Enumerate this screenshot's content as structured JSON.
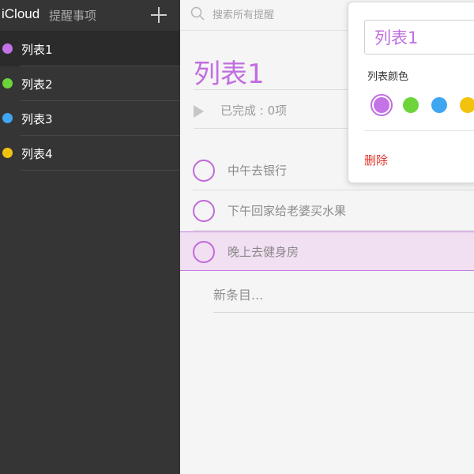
{
  "sidebar": {
    "brand": "iCloud",
    "app_name": "提醒事项",
    "lists": [
      {
        "label": "列表1",
        "color": "#c373e6",
        "active": true
      },
      {
        "label": "列表2",
        "color": "#6dd43a",
        "active": false
      },
      {
        "label": "列表3",
        "color": "#3fa6f2",
        "active": false
      },
      {
        "label": "列表4",
        "color": "#f2c30e",
        "active": false
      }
    ]
  },
  "main": {
    "search_placeholder": "搜索所有提醒",
    "title": "列表1",
    "completed": "已完成 : 0项",
    "reminders": [
      {
        "text": "中午去银行",
        "selected": false
      },
      {
        "text": "下午回家给老婆买水果",
        "selected": false
      },
      {
        "text": "晚上去健身房",
        "selected": true
      }
    ],
    "new_item": "新条目..."
  },
  "popover": {
    "name_value": "列表1",
    "color_label": "列表颜色",
    "colors": [
      "#c373e6",
      "#6dd43a",
      "#3fa6f2",
      "#f2c30e"
    ],
    "selected_color": "#c373e6",
    "delete_label": "删除"
  },
  "colors": {
    "accent": "#c16ee0",
    "sidebar_bg": "#353535",
    "delete": "#e0362c"
  }
}
